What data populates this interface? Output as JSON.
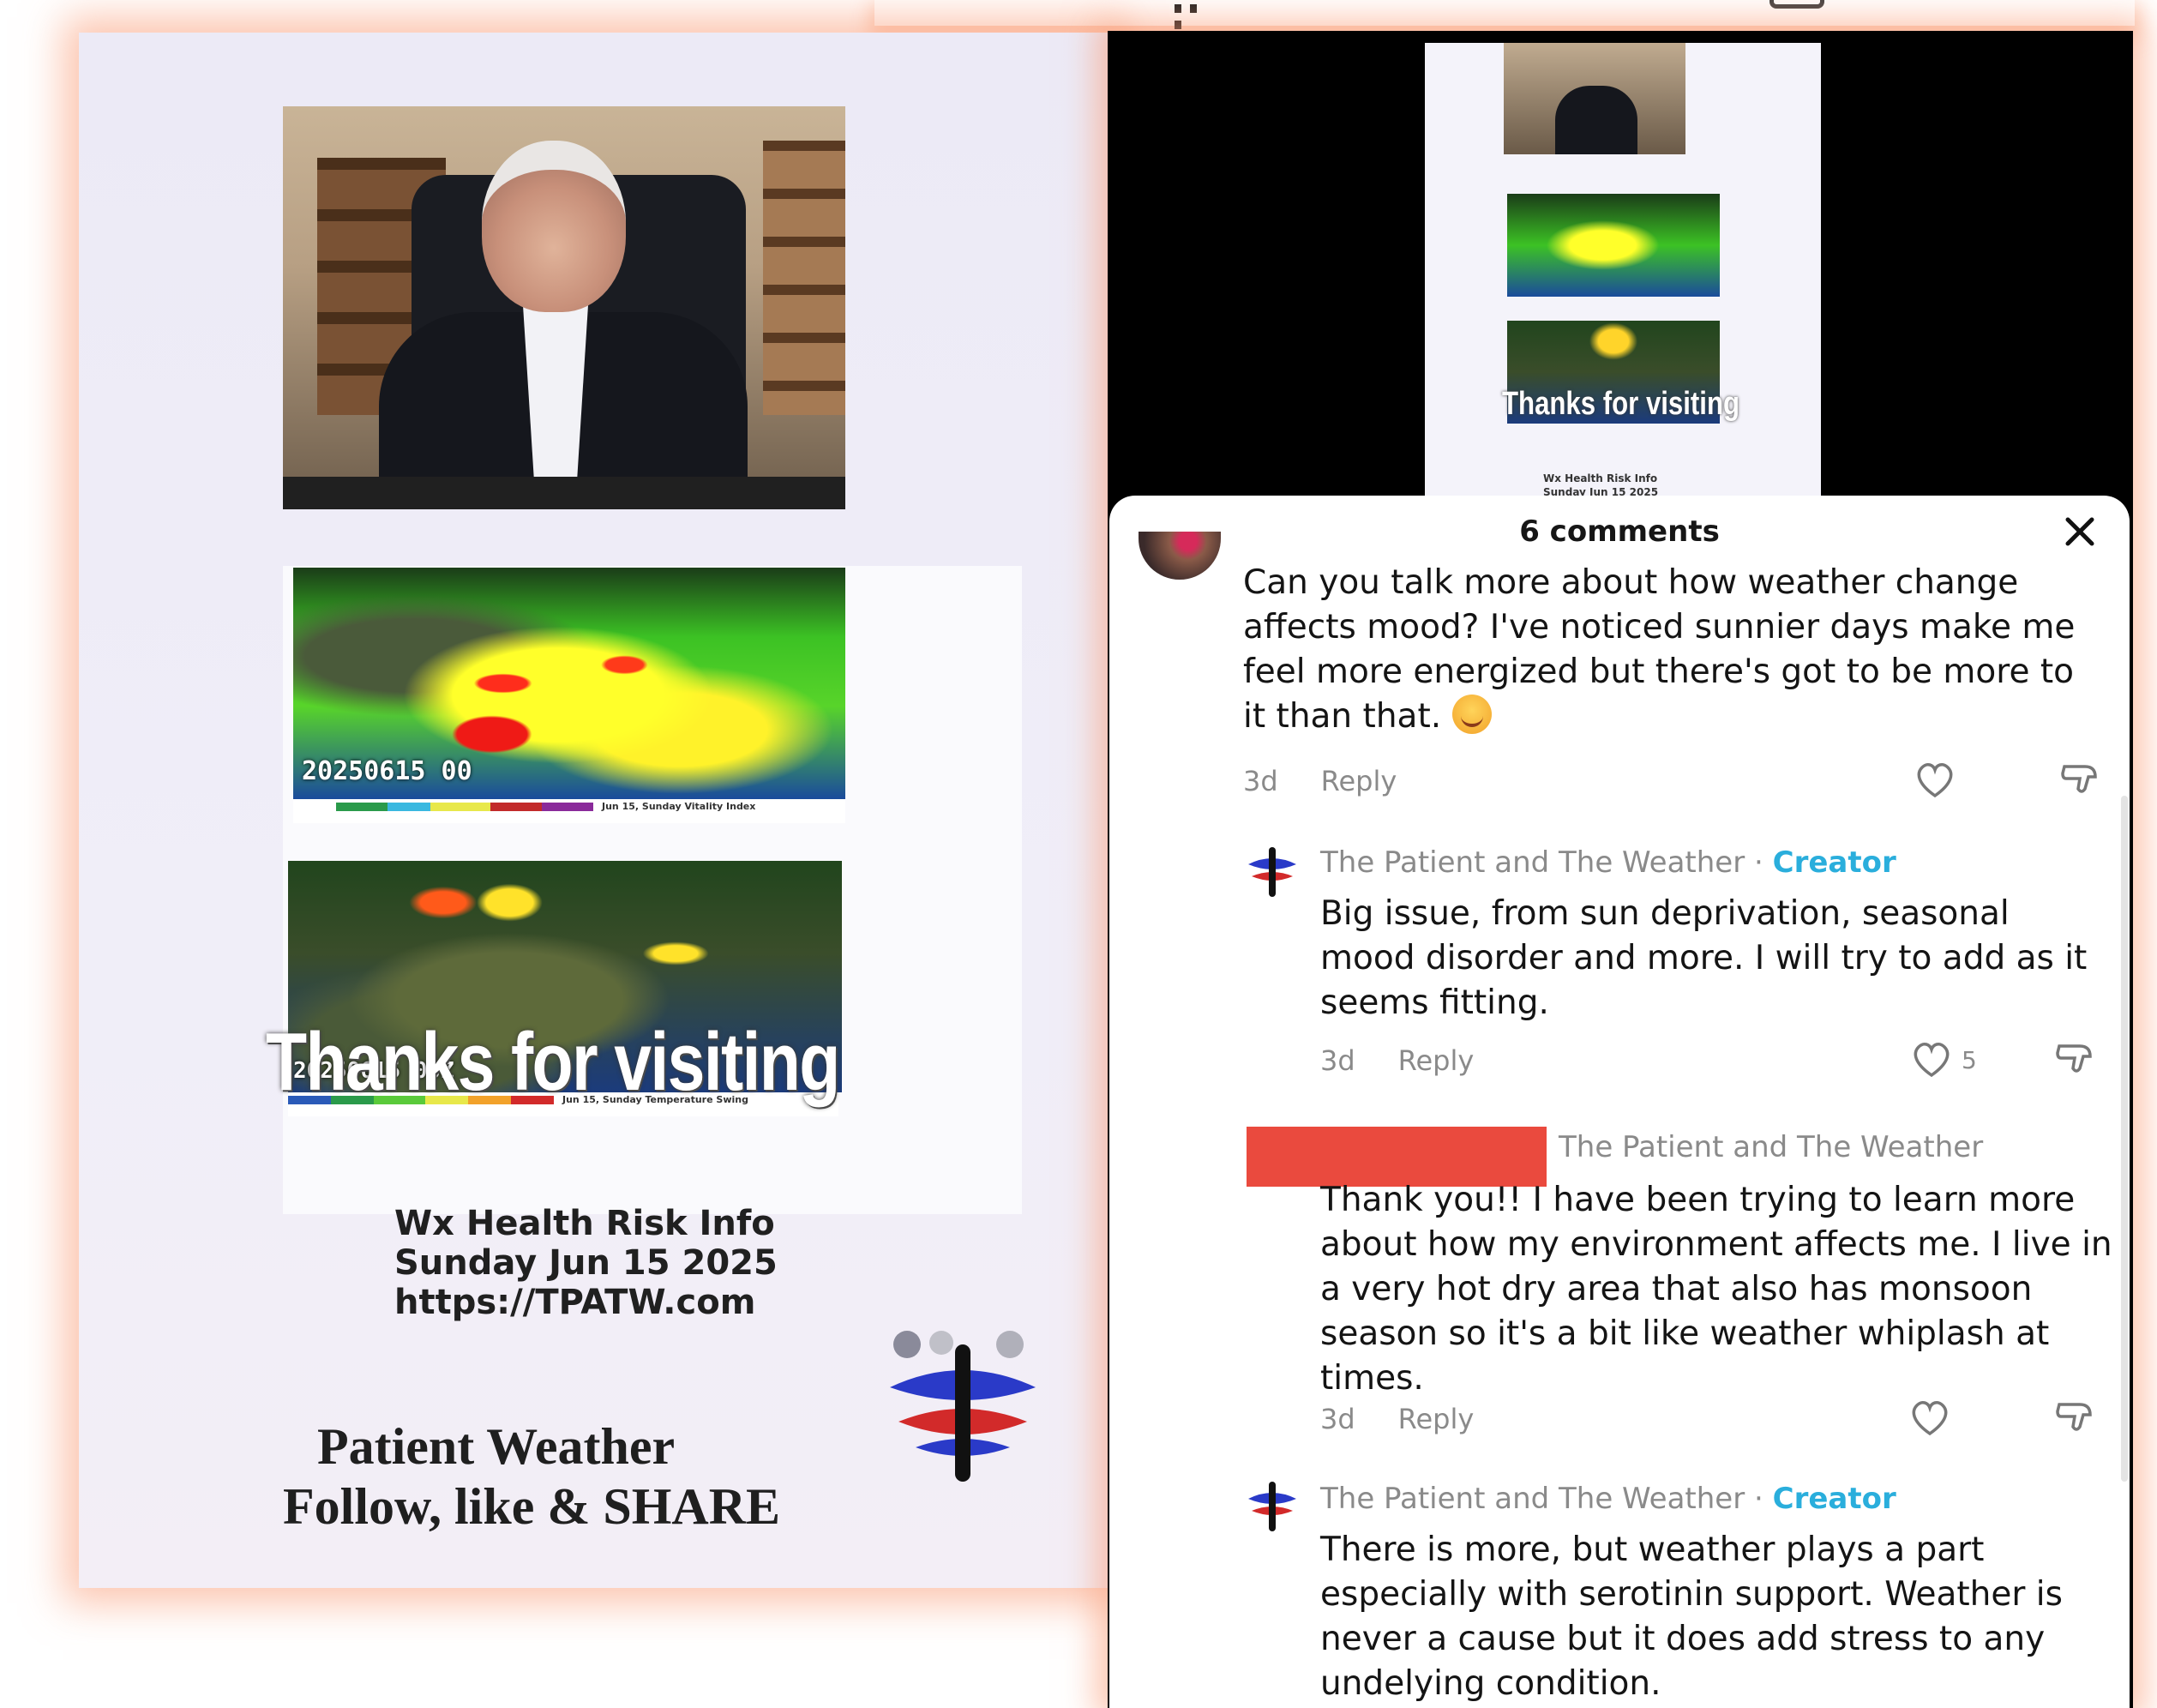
{
  "left_post": {
    "map1_date": "20250615 00",
    "map1_caption": "Jun 15, Sunday Vitality Index",
    "map2_date": "20250615 00Z",
    "map2_caption": "Jun 15, Sunday Temperature Swing",
    "overlay_text": "Thanks for visiting",
    "info_line1": "Wx Health Risk Info",
    "info_line2": "Sunday Jun 15 2025",
    "info_line3": "https://TPATW.com",
    "footer_line1": "Patient Weather",
    "footer_line2": "Follow, like & SHARE"
  },
  "right_post": {
    "mini_overlay_text": "Thanks for visiting",
    "mini_info_line1": "Wx Health Risk Info",
    "mini_info_line2": "Sunday Jun 15 2025"
  },
  "comments_sheet": {
    "title": "6 comments",
    "comments": [
      {
        "text_lines": [
          "Can you talk more about how weather change",
          "affects mood? I've noticed sunnier days make me",
          "feel more energized but there's got to be more to",
          "it than that."
        ],
        "age": "3d",
        "reply_label": "Reply",
        "likes": ""
      },
      {
        "author": "The Patient and The Weather",
        "badge": "Creator",
        "text_lines": [
          "Big issue, from sun deprivation, seasonal",
          "mood disorder and more. I will try to add as it",
          "seems fitting."
        ],
        "age": "3d",
        "reply_label": "Reply",
        "likes": "5"
      },
      {
        "reply_to": "The Patient and The Weather",
        "text_lines": [
          "Thank you!! I have been trying to learn more",
          "about how my environment affects me. I live in",
          "a very hot dry area that also has monsoon",
          "season so it's a bit like weather whiplash at",
          "times."
        ],
        "age": "3d",
        "reply_label": "Reply",
        "likes": ""
      },
      {
        "author": "The Patient and The Weather",
        "badge": "Creator",
        "text_lines": [
          "There is more, but weather plays a part",
          "especially with serotinin support. Weather is",
          "never a cause but it does add stress to any",
          "undelying condition."
        ]
      }
    ]
  },
  "colors": {
    "accent_creator": "#2aaedc",
    "redaction": "#ea4a3e",
    "glow": "#faa078"
  }
}
